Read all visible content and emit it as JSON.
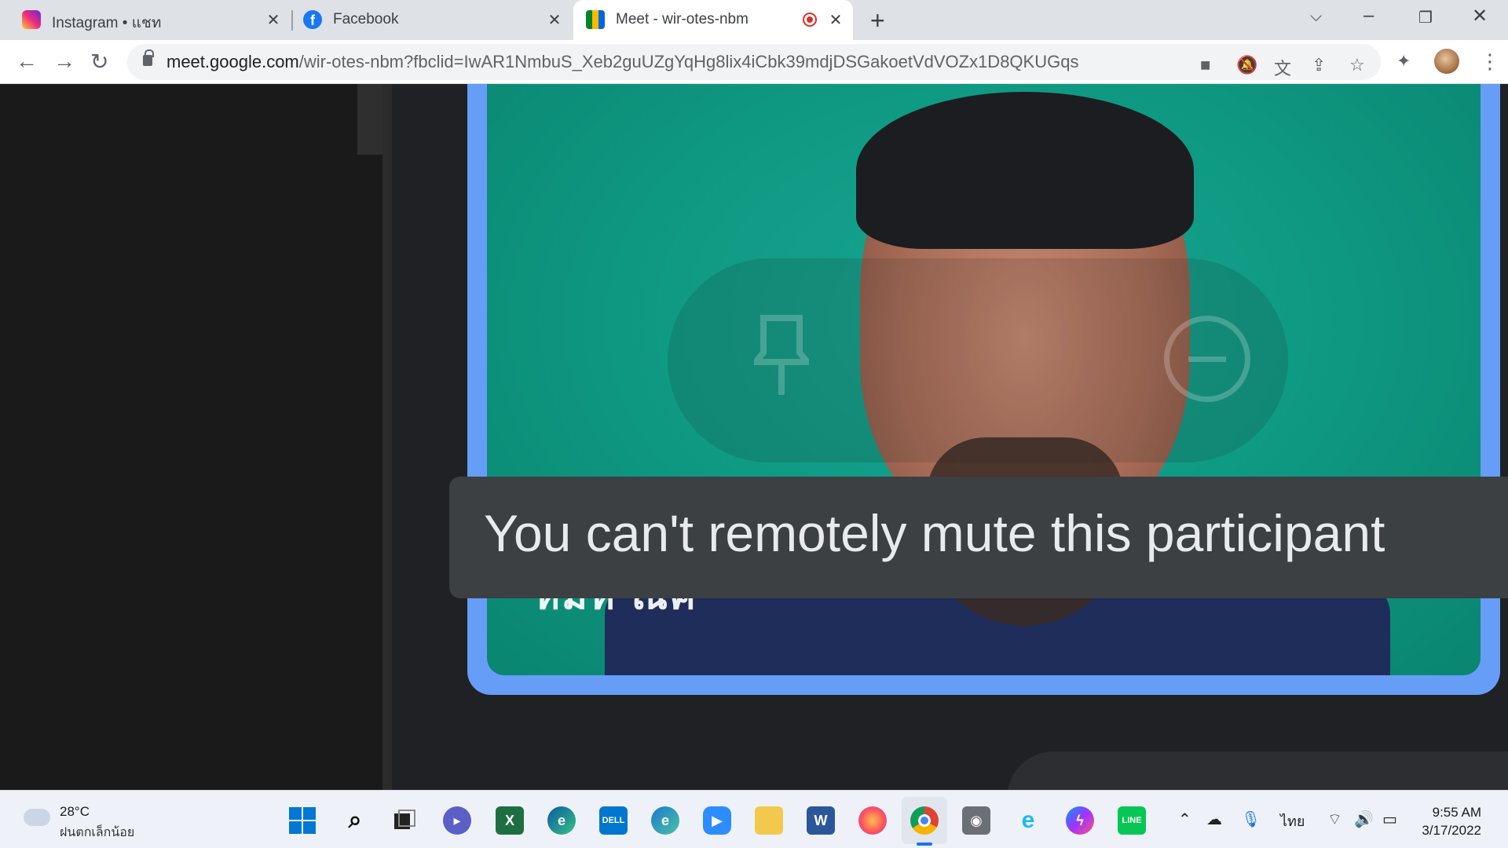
{
  "browser": {
    "tabs": [
      {
        "title": "Instagram • แชท",
        "favicon": "instagram-icon"
      },
      {
        "title": "Facebook",
        "favicon": "facebook-icon"
      },
      {
        "title": "Meet - wir-otes-nbm",
        "favicon": "google-meet-icon",
        "active": true,
        "recording": true
      }
    ],
    "url_host": "meet.google.com",
    "url_path": "/wir-otes-nbm?fbclid=IwAR1NmbuS_Xeb2guUZgYqHg8lix4iCbk39mdjDSGakoetVdVOZx1D8QKUGqs"
  },
  "meet": {
    "toast": "You can't remotely mute this participant",
    "caption_partial": "ห็ม่ห ิณ็ค",
    "accent_color": "#669df6",
    "speaking_color": "#1a73e8"
  },
  "taskbar": {
    "weather_temp": "28°C",
    "weather_desc": "ฝนตกเล็กน้อย",
    "language": "ไทย",
    "time": "9:55 AM",
    "date": "3/17/2022",
    "apps": [
      "windows-start",
      "search",
      "task-view",
      "teams-chat",
      "excel",
      "edge",
      "dell",
      "edge-beta",
      "zoom",
      "file-explorer",
      "word",
      "firefox",
      "chrome",
      "camera",
      "internet-explorer",
      "messenger",
      "line"
    ]
  }
}
